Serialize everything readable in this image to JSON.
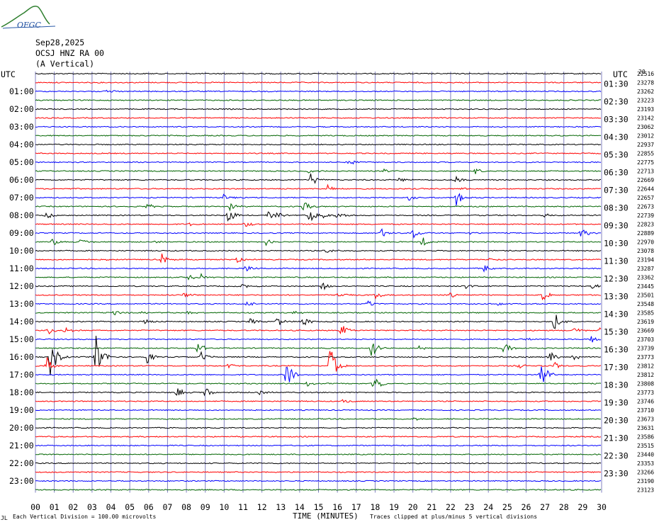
{
  "logo": {
    "text": "OFGC"
  },
  "header": {
    "date": "Sep28,2025",
    "station": "OCSJ HNZ RA 00",
    "component": "(A Vertical)"
  },
  "axis": {
    "left_title": "UTC",
    "right_title": "UTC",
    "xlabel": "TIME (MINUTES)",
    "note_left": "Each Vertical Division =  100.00 microvolts",
    "note_right": "Traces clipped at plus/minus 5 vertical divisions",
    "corner_mark": "JL",
    "top_right_tag": "20"
  },
  "colors": {
    "trace_cycle": [
      "#000000",
      "#ff0000",
      "#0000ff",
      "#006400"
    ],
    "grid": "#8080c0"
  },
  "chart_data": {
    "type": "line",
    "title": "OCSJ HNZ RA 00 (A Vertical)",
    "xlabel": "TIME (MINUTES)",
    "xlim": [
      0,
      30
    ],
    "x_ticks": [
      "00",
      "01",
      "02",
      "03",
      "04",
      "05",
      "06",
      "07",
      "08",
      "09",
      "10",
      "11",
      "12",
      "13",
      "14",
      "15",
      "16",
      "17",
      "18",
      "19",
      "20",
      "21",
      "22",
      "23",
      "24",
      "25",
      "26",
      "27",
      "28",
      "29",
      "30"
    ],
    "left_hour_labels": [
      "01:00",
      "02:00",
      "03:00",
      "04:00",
      "05:00",
      "06:00",
      "07:00",
      "08:00",
      "09:00",
      "10:00",
      "11:00",
      "12:00",
      "13:00",
      "14:00",
      "15:00",
      "16:00",
      "17:00",
      "18:00",
      "19:00",
      "20:00",
      "21:00",
      "22:00",
      "23:00"
    ],
    "right_hour_labels": [
      "01:30",
      "02:30",
      "03:30",
      "04:30",
      "05:30",
      "06:30",
      "07:30",
      "08:30",
      "09:30",
      "10:30",
      "11:30",
      "12:30",
      "13:30",
      "14:30",
      "15:30",
      "16:30",
      "17:30",
      "18:30",
      "19:30",
      "20:30",
      "21:30",
      "22:30",
      "23:30"
    ],
    "trace_counts": [
      22516,
      23278,
      23262,
      23223,
      23193,
      23142,
      23062,
      23012,
      22937,
      22855,
      22775,
      22713,
      22669,
      22644,
      22657,
      22673,
      22739,
      22823,
      22889,
      22970,
      23078,
      23194,
      23287,
      23362,
      23445,
      23501,
      23548,
      23585,
      23619,
      23669,
      23703,
      23739,
      23773,
      23812,
      23812,
      23808,
      23773,
      23746,
      23710,
      23673,
      23631,
      23586,
      23515,
      23440,
      23353,
      23266,
      23190,
      23123
    ],
    "events": [
      {
        "trace": 2,
        "minute": 3.7,
        "amp": 4
      },
      {
        "trace": 10,
        "minute": 16.6,
        "amp": 5
      },
      {
        "trace": 11,
        "minute": 14.5,
        "amp": 5
      },
      {
        "trace": 11,
        "minute": 18.5,
        "amp": 4
      },
      {
        "trace": 11,
        "minute": 23.3,
        "amp": 5
      },
      {
        "trace": 12,
        "minute": 14.6,
        "amp": 11
      },
      {
        "trace": 12,
        "minute": 19.3,
        "amp": 4
      },
      {
        "trace": 12,
        "minute": 22.3,
        "amp": 6
      },
      {
        "trace": 13,
        "minute": 15.5,
        "amp": 6
      },
      {
        "trace": 13,
        "minute": 22.6,
        "amp": 3
      },
      {
        "trace": 14,
        "minute": 10.0,
        "amp": 6
      },
      {
        "trace": 14,
        "minute": 19.8,
        "amp": 5
      },
      {
        "trace": 14,
        "minute": 22.3,
        "amp": 12
      },
      {
        "trace": 15,
        "minute": 5.9,
        "amp": 5
      },
      {
        "trace": 15,
        "minute": 10.3,
        "amp": 8
      },
      {
        "trace": 15,
        "minute": 14.2,
        "amp": 8
      },
      {
        "trace": 16,
        "minute": 0.6,
        "amp": 6
      },
      {
        "trace": 16,
        "minute": 10.2,
        "amp": 12
      },
      {
        "trace": 16,
        "minute": 12.3,
        "amp": 6
      },
      {
        "trace": 16,
        "minute": 12.8,
        "amp": 6
      },
      {
        "trace": 16,
        "minute": 14.5,
        "amp": 12
      },
      {
        "trace": 16,
        "minute": 15.3,
        "amp": 6
      },
      {
        "trace": 16,
        "minute": 16.0,
        "amp": 8
      },
      {
        "trace": 16,
        "minute": 27.0,
        "amp": 3
      },
      {
        "trace": 17,
        "minute": 8.2,
        "amp": 2
      },
      {
        "trace": 17,
        "minute": 11.1,
        "amp": 7
      },
      {
        "trace": 18,
        "minute": 18.3,
        "amp": 8
      },
      {
        "trace": 18,
        "minute": 20.0,
        "amp": 9
      },
      {
        "trace": 18,
        "minute": 23.0,
        "amp": 3
      },
      {
        "trace": 18,
        "minute": 28.9,
        "amp": 9
      },
      {
        "trace": 19,
        "minute": 0.9,
        "amp": 7
      },
      {
        "trace": 19,
        "minute": 2.4,
        "amp": 6
      },
      {
        "trace": 19,
        "minute": 6.3,
        "amp": 3
      },
      {
        "trace": 19,
        "minute": 12.2,
        "amp": 6
      },
      {
        "trace": 19,
        "minute": 20.5,
        "amp": 8
      },
      {
        "trace": 20,
        "minute": 15.4,
        "amp": 6
      },
      {
        "trace": 21,
        "minute": 3.8,
        "amp": 2
      },
      {
        "trace": 21,
        "minute": 6.7,
        "amp": 9
      },
      {
        "trace": 21,
        "minute": 10.6,
        "amp": 6
      },
      {
        "trace": 21,
        "minute": 24.0,
        "amp": 3
      },
      {
        "trace": 22,
        "minute": 11.1,
        "amp": 6
      },
      {
        "trace": 22,
        "minute": 23.8,
        "amp": 6
      },
      {
        "trace": 23,
        "minute": 8.1,
        "amp": 5
      },
      {
        "trace": 23,
        "minute": 8.8,
        "amp": 5
      },
      {
        "trace": 24,
        "minute": 10.9,
        "amp": 6
      },
      {
        "trace": 24,
        "minute": 15.2,
        "amp": 8
      },
      {
        "trace": 24,
        "minute": 22.7,
        "amp": 6
      },
      {
        "trace": 24,
        "minute": 29.5,
        "amp": 4
      },
      {
        "trace": 25,
        "minute": 7.9,
        "amp": 6
      },
      {
        "trace": 25,
        "minute": 16.0,
        "amp": 9
      },
      {
        "trace": 25,
        "minute": 18.0,
        "amp": 9
      },
      {
        "trace": 25,
        "minute": 22.0,
        "amp": 4
      },
      {
        "trace": 25,
        "minute": 26.9,
        "amp": 9
      },
      {
        "trace": 26,
        "minute": 11.2,
        "amp": 4
      },
      {
        "trace": 26,
        "minute": 17.6,
        "amp": 6
      },
      {
        "trace": 26,
        "minute": 24.5,
        "amp": 4
      },
      {
        "trace": 27,
        "minute": 4.1,
        "amp": 6
      },
      {
        "trace": 27,
        "minute": 5.5,
        "amp": 4
      },
      {
        "trace": 27,
        "minute": 8.1,
        "amp": 4
      },
      {
        "trace": 27,
        "minute": 13.6,
        "amp": 4
      },
      {
        "trace": 28,
        "minute": 5.8,
        "amp": 6
      },
      {
        "trace": 28,
        "minute": 11.4,
        "amp": 5
      },
      {
        "trace": 28,
        "minute": 12.8,
        "amp": 8
      },
      {
        "trace": 28,
        "minute": 14.2,
        "amp": 8
      },
      {
        "trace": 28,
        "minute": 27.5,
        "amp": 14
      },
      {
        "trace": 29,
        "minute": 0.7,
        "amp": 8
      },
      {
        "trace": 29,
        "minute": 1.6,
        "amp": 6
      },
      {
        "trace": 29,
        "minute": 16.2,
        "amp": 10
      },
      {
        "trace": 29,
        "minute": 28.5,
        "amp": 6
      },
      {
        "trace": 29,
        "minute": 29.9,
        "amp": 9
      },
      {
        "trace": 30,
        "minute": 26.0,
        "amp": 3
      },
      {
        "trace": 30,
        "minute": 29.4,
        "amp": 8
      },
      {
        "trace": 31,
        "minute": 8.6,
        "amp": 10
      },
      {
        "trace": 31,
        "minute": 17.8,
        "amp": 14
      },
      {
        "trace": 31,
        "minute": 20.3,
        "amp": 4
      },
      {
        "trace": 31,
        "minute": 24.8,
        "amp": 12
      },
      {
        "trace": 32,
        "minute": 0.8,
        "amp": 30
      },
      {
        "trace": 32,
        "minute": 3.2,
        "amp": 34
      },
      {
        "trace": 32,
        "minute": 5.9,
        "amp": 10
      },
      {
        "trace": 32,
        "minute": 8.8,
        "amp": 8
      },
      {
        "trace": 32,
        "minute": 27.2,
        "amp": 12
      },
      {
        "trace": 32,
        "minute": 28.5,
        "amp": 5
      },
      {
        "trace": 33,
        "minute": 0.6,
        "amp": 14
      },
      {
        "trace": 33,
        "minute": 10.2,
        "amp": 4
      },
      {
        "trace": 33,
        "minute": 15.6,
        "amp": 30
      },
      {
        "trace": 33,
        "minute": 25.6,
        "amp": 4
      },
      {
        "trace": 33,
        "minute": 27.5,
        "amp": 6
      },
      {
        "trace": 34,
        "minute": 13.3,
        "amp": 22
      },
      {
        "trace": 34,
        "minute": 26.8,
        "amp": 24
      },
      {
        "trace": 35,
        "minute": 14.4,
        "amp": 4
      },
      {
        "trace": 35,
        "minute": 17.9,
        "amp": 20
      },
      {
        "trace": 36,
        "minute": 7.5,
        "amp": 8
      },
      {
        "trace": 36,
        "minute": 9.0,
        "amp": 8
      },
      {
        "trace": 36,
        "minute": 11.9,
        "amp": 5
      },
      {
        "trace": 37,
        "minute": 16.3,
        "amp": 4
      },
      {
        "trace": 39,
        "minute": 20.1,
        "amp": 3
      }
    ]
  }
}
